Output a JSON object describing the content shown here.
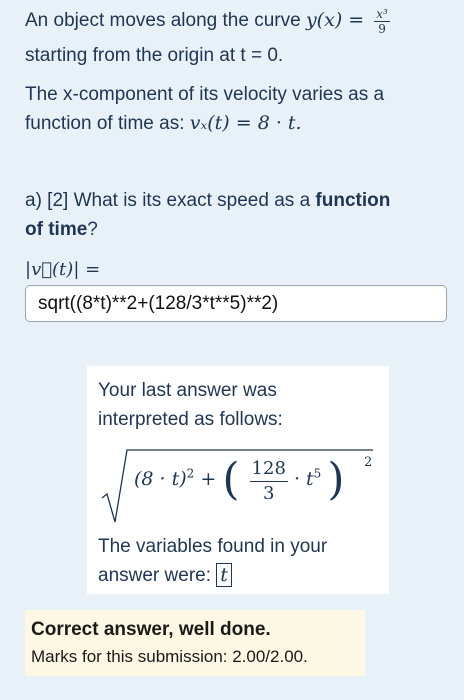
{
  "question": {
    "intro_text": "An object moves along the curve",
    "curve_lhs": "y(x) =",
    "curve_num": "x³",
    "curve_den": "9",
    "intro_text2": "starting from the origin at t = 0.",
    "velocity_text1": "The x-component of its velocity varies as a",
    "velocity_text2": "function of time as:",
    "velocity_math": "vₓ(t) = 8 · t."
  },
  "part_a": {
    "prefix": "a) [2] What is its exact speed as a",
    "bold_word": "function",
    "line2_bold": "of time",
    "line2_end": "?",
    "speed_label": "|v⃗(t)| ="
  },
  "answer_input": {
    "value": "sqrt((8*t)**2+(128/3*t**5)**2)"
  },
  "preview": {
    "line1": "Your last answer was",
    "line2": "interpreted as follows:",
    "term1": "(8 · t)",
    "term1_exp": "2",
    "plus": "+",
    "frac_num": "128",
    "frac_den": "3",
    "times_t": "· t",
    "t_exp": "5",
    "outer_exp": "2",
    "vars_line1": "The variables found in your",
    "vars_line2": "answer were:",
    "variables": "t"
  },
  "feedback": {
    "headline": "Correct answer, well done.",
    "marks": "Marks for this submission: 2.00/2.00."
  }
}
